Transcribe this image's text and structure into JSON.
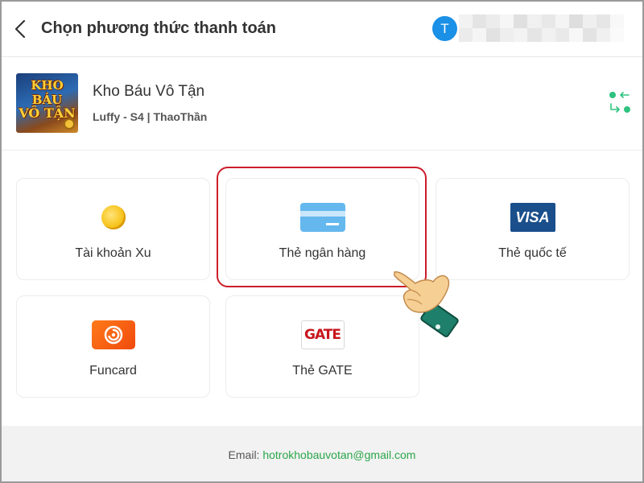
{
  "header": {
    "title": "Chọn phương thức thanh toán",
    "avatar_letter": "T",
    "avatar_color": "#1a90e6"
  },
  "game": {
    "name": "Kho Báu Vô Tận",
    "server": "Luffy - S4 | ThaoThần",
    "logo_text_top": "KHO BÁU",
    "logo_text_bottom": "VÔ TẬN"
  },
  "payment_methods": [
    {
      "label": "Tài khoản Xu",
      "icon": "coin-icon"
    },
    {
      "label": "Thẻ ngân hàng",
      "icon": "bank-card-icon",
      "highlighted": true
    },
    {
      "label": "Thẻ quốc tế",
      "icon": "visa-icon",
      "icon_text": "VISA"
    },
    {
      "label": "Funcard",
      "icon": "funcard-icon"
    },
    {
      "label": "Thẻ GATE",
      "icon": "gate-icon",
      "icon_text": "GATE"
    }
  ],
  "footer": {
    "email_label": "Email:",
    "email": "hotrokhobauvotan@gmail.com"
  },
  "colors": {
    "accent_green": "#2aa64a",
    "highlight_red": "#cc1d2b",
    "visa_blue": "#1a4f8c",
    "funcard_orange": "#f04a0c",
    "gate_red": "#c7161d"
  }
}
